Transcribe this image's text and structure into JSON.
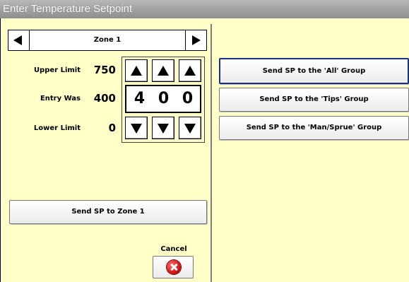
{
  "window": {
    "title": "Enter Temperature Setpoint"
  },
  "zone_selector": {
    "label": "Zone 1"
  },
  "limits": {
    "upper_label": "Upper Limit",
    "upper_value": "750",
    "entry_label": "Entry Was",
    "entry_value": "400",
    "lower_label": "Lower Limit",
    "lower_value": "0"
  },
  "entry_digits": [
    "4",
    "0",
    "0"
  ],
  "buttons": {
    "send_zone": "Send SP to Zone 1",
    "cancel_label": "Cancel"
  },
  "groups": [
    {
      "label": "Send SP to the 'All' Group",
      "selected": true
    },
    {
      "label": "Send SP to the 'Tips' Group",
      "selected": false
    },
    {
      "label": "Send SP to the 'Man/Sprue' Group",
      "selected": false
    }
  ],
  "colors": {
    "background": "#ffffc8",
    "titlebar": "#9e9e9e",
    "selected_border": "#1a2f8a",
    "cancel_icon": "#d11414"
  }
}
